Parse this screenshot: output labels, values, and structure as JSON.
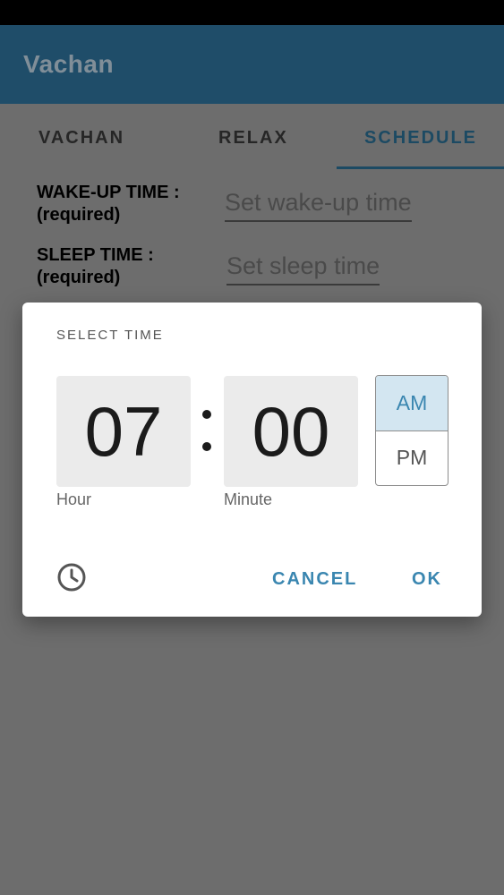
{
  "app": {
    "title": "Vachan"
  },
  "tabs": [
    {
      "label": "VACHAN"
    },
    {
      "label": "RELAX"
    },
    {
      "label": "SCHEDULE"
    }
  ],
  "form": {
    "wake": {
      "label": "WAKE-UP TIME :",
      "note": "(required)",
      "placeholder": "Set wake-up time"
    },
    "sleep": {
      "label": "SLEEP TIME :",
      "note": "(required)",
      "placeholder": "Set sleep time"
    }
  },
  "dialog": {
    "title": "SELECT TIME",
    "hour": "07",
    "minute": "00",
    "hour_label": "Hour",
    "minute_label": "Minute",
    "am": "AM",
    "pm": "PM",
    "selected_period": "AM",
    "cancel": "CANCEL",
    "ok": "OK"
  },
  "icons": {
    "mode_toggle": "clock-icon"
  },
  "colors": {
    "app_bar": "#1f4d69",
    "accent": "#3a86b0",
    "scrim": "#6d6d6d"
  }
}
